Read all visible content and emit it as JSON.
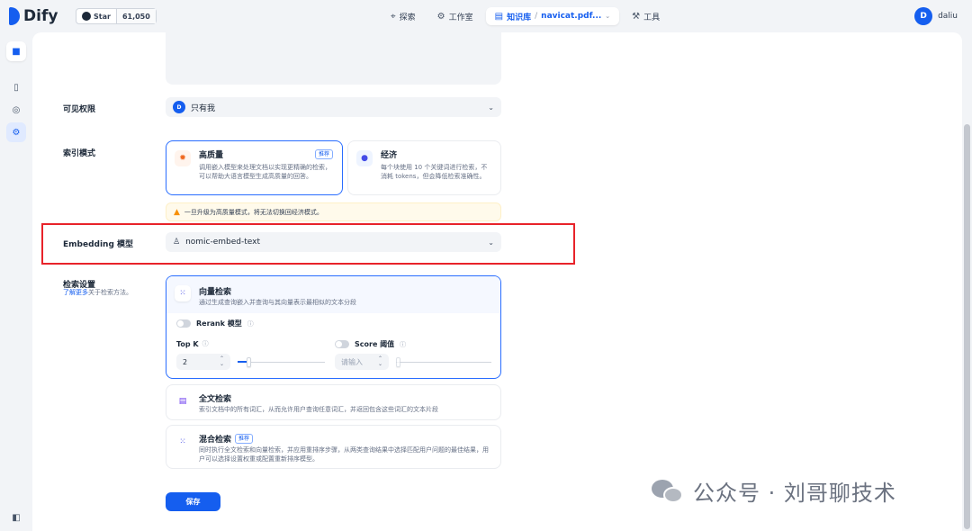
{
  "app": {
    "logo_text": "Dify",
    "github_label": "Star",
    "github_stars": "61,050"
  },
  "nav": {
    "explore": "探索",
    "studio": "工作室",
    "knowledge": "知识库",
    "separator": "/",
    "dataset": "navicat.pdf...",
    "tools": "工具"
  },
  "user": {
    "initial": "D",
    "name": "daliu"
  },
  "form": {
    "visibility": {
      "label": "可见权限",
      "avatar_initial": "D",
      "value": "只有我"
    },
    "index_mode": {
      "label": "索引模式",
      "high_quality": {
        "title": "高质量",
        "badge": "推荐",
        "desc": "调用嵌入模型来处理文档以实现更精确的检索，可以帮助大语言模型生成高质量的回答。"
      },
      "economy": {
        "title": "经济",
        "desc": "每个块使用 10 个关键词进行检索，不消耗 tokens，但会降低检索准确性。"
      },
      "warning": "一旦升级为高质量模式，将无法切换回经济模式。"
    },
    "embedding": {
      "label": "Embedding 模型",
      "value": "nomic-embed-text"
    },
    "retrieval": {
      "label": "检索设置",
      "learn_more": "了解更多",
      "learn_more_suffix": "关于检索方法。",
      "vector": {
        "title": "向量检索",
        "desc": "通过生成查询嵌入并查询与其向量表示最相似的文本分段",
        "rerank_label": "Rerank 模型",
        "topk_label": "Top K",
        "topk_value": "2",
        "topk_fraction": 0.04,
        "score_label": "Score 阈值",
        "score_placeholder": "请输入"
      },
      "fulltext": {
        "title": "全文检索",
        "desc": "索引文档中的所有词汇，从而允许用户查询任意词汇，并返回包含这些词汇的文本片段"
      },
      "hybrid": {
        "title": "混合检索",
        "badge": "推荐",
        "desc": "同时执行全文检索和向量检索，并应用重排序步骤，从两类查询结果中选择匹配用户问题的最佳结果，用户可以选择设置权重或配置重新排序模型。"
      }
    },
    "save_label": "保存"
  },
  "watermark": {
    "text": "公众号 · 刘哥聊技术"
  },
  "colors": {
    "primary": "#155eef",
    "highlight_box": "#e8232a",
    "warning": "#f79009"
  }
}
